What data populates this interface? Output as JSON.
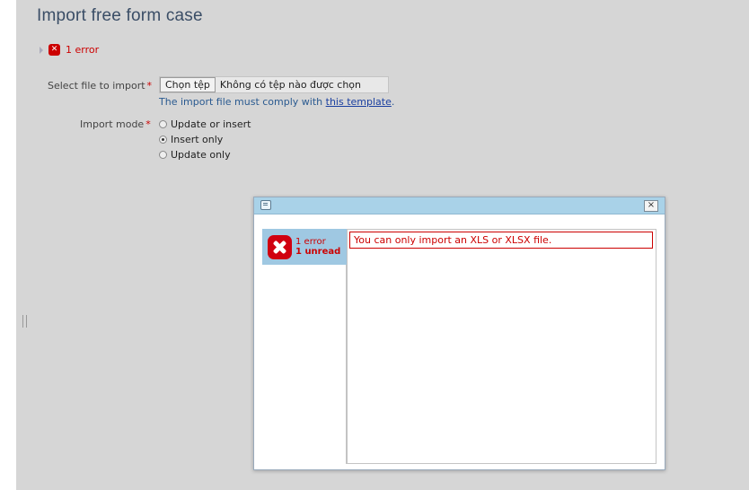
{
  "page": {
    "title": "Import free form case",
    "error_summary": "1 error"
  },
  "form": {
    "file_label": "Select file to import",
    "required_mark": "*",
    "file_button": "Chọn tệp",
    "file_none": "Không có tệp nào được chọn",
    "hint_prefix": "The import file must comply with",
    "hint_link": "this template",
    "hint_suffix": ".",
    "mode_label": "Import mode",
    "modes": [
      {
        "label": "Update or insert",
        "selected": false
      },
      {
        "label": "Insert only",
        "selected": true
      },
      {
        "label": "Update only",
        "selected": false
      }
    ]
  },
  "dialog": {
    "close_glyph": "×",
    "side_errors": "1 error",
    "side_unread": "1 unread",
    "message": "You can only import an XLS or XLSX file."
  },
  "colors": {
    "error": "#cc0000",
    "dialog_header": "#a9d2e8",
    "side_tab": "#9fc8e2"
  }
}
